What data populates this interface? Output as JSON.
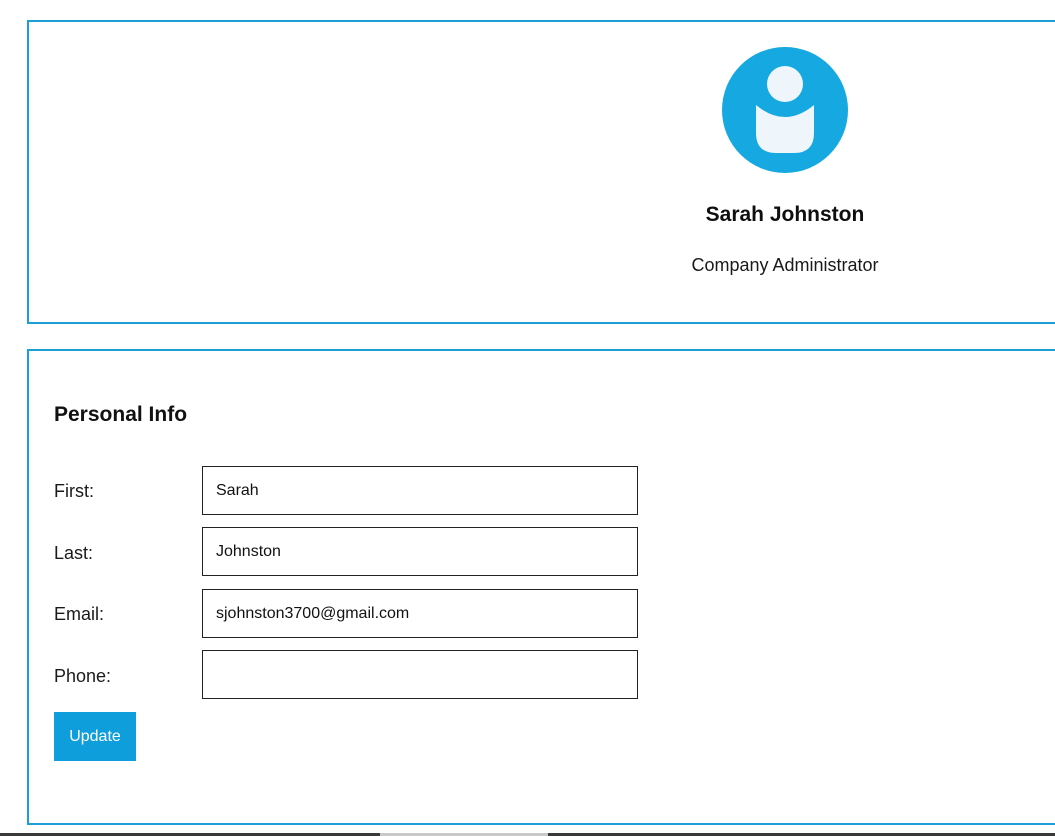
{
  "profile": {
    "avatar_icon": "user-avatar-icon",
    "name": "Sarah Johnston",
    "role": "Company Administrator"
  },
  "personal_info": {
    "title": "Personal Info",
    "fields": {
      "first": {
        "label": "First:",
        "value": "Sarah"
      },
      "last": {
        "label": "Last:",
        "value": "Johnston"
      },
      "email": {
        "label": "Email:",
        "value": "sjohnston3700@gmail.com"
      },
      "phone": {
        "label": "Phone:",
        "value": ""
      }
    },
    "update_label": "Update"
  },
  "colors": {
    "accent": "#1a9fd6",
    "button": "#0f9edc",
    "avatar_bg": "#16a8e0"
  }
}
